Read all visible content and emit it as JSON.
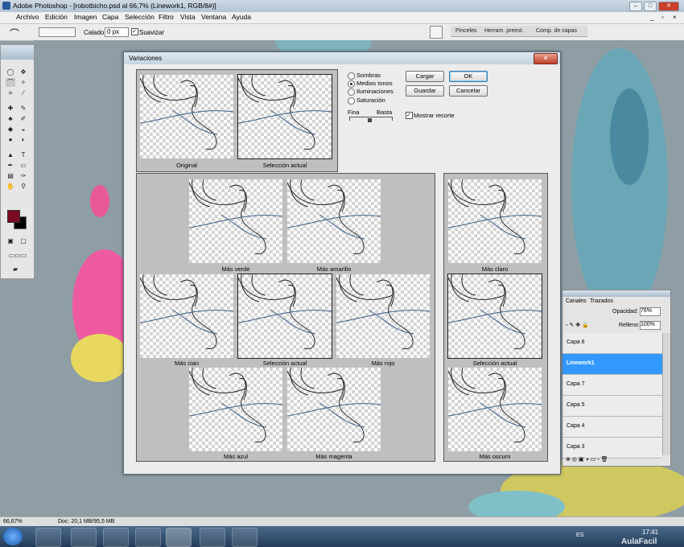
{
  "window": {
    "title": "Adobe Photoshop - [robotbicho.psd al 66,7% (Linework1, RGB/8#)]"
  },
  "menu": [
    "Archivo",
    "Edición",
    "Imagen",
    "Capa",
    "Selección",
    "Filtro",
    "Vista",
    "Ventana",
    "Ayuda"
  ],
  "options": {
    "feather_label": "Calado:",
    "feather_value": "0 px",
    "smooth_label": "Suavizar"
  },
  "palette_well": [
    "Pinceles",
    "Herram. preest.",
    "Comp. de capas"
  ],
  "dialog": {
    "title": "Variaciones",
    "top_thumbs": [
      {
        "label": "Original"
      },
      {
        "label": "Selección actual"
      }
    ],
    "radios": [
      {
        "label": "Sombras",
        "checked": false
      },
      {
        "label": "Medios tonos",
        "checked": true
      },
      {
        "label": "Iluminaciones",
        "checked": false
      },
      {
        "label": "Saturación",
        "checked": false
      }
    ],
    "slider": {
      "left": "Fina",
      "right": "Basta"
    },
    "buttons": {
      "load": "Cargar",
      "ok": "OK",
      "save": "Guardar",
      "cancel": "Cancelar"
    },
    "clipping": {
      "label": "Mostrar recorte",
      "checked": true
    },
    "grid": {
      "row1": [
        "Más verde",
        "Más amarillo"
      ],
      "row2": [
        "Más cian",
        "Selección actual",
        "Más rojo"
      ],
      "row3": [
        "Más azul",
        "Más magenta"
      ]
    },
    "side": [
      "Más claro",
      "Selección actual",
      "Más oscuro"
    ]
  },
  "layers_panel": {
    "tabs": [
      "Canales",
      "Trazados"
    ],
    "opacity_label": "Opacidad:",
    "opacity_value": "76%",
    "fill_label": "Relleno:",
    "fill_value": "100%",
    "layers": [
      {
        "name": "Capa 6"
      },
      {
        "name": "Linework1",
        "active": true
      },
      {
        "name": "Capa 7"
      },
      {
        "name": "Capa 5"
      },
      {
        "name": "Capa 4"
      },
      {
        "name": "Capa 3"
      }
    ]
  },
  "status": {
    "zoom": "66,67%",
    "doc": "Doc: 20,1 MB/95,5 MB"
  },
  "taskbar": {
    "lang": "ES",
    "time": "17:41",
    "watermark": "AulaFacil"
  },
  "colors": {
    "foreground": "#7a0a22",
    "background": "#000000",
    "accent": "#3399ff"
  }
}
